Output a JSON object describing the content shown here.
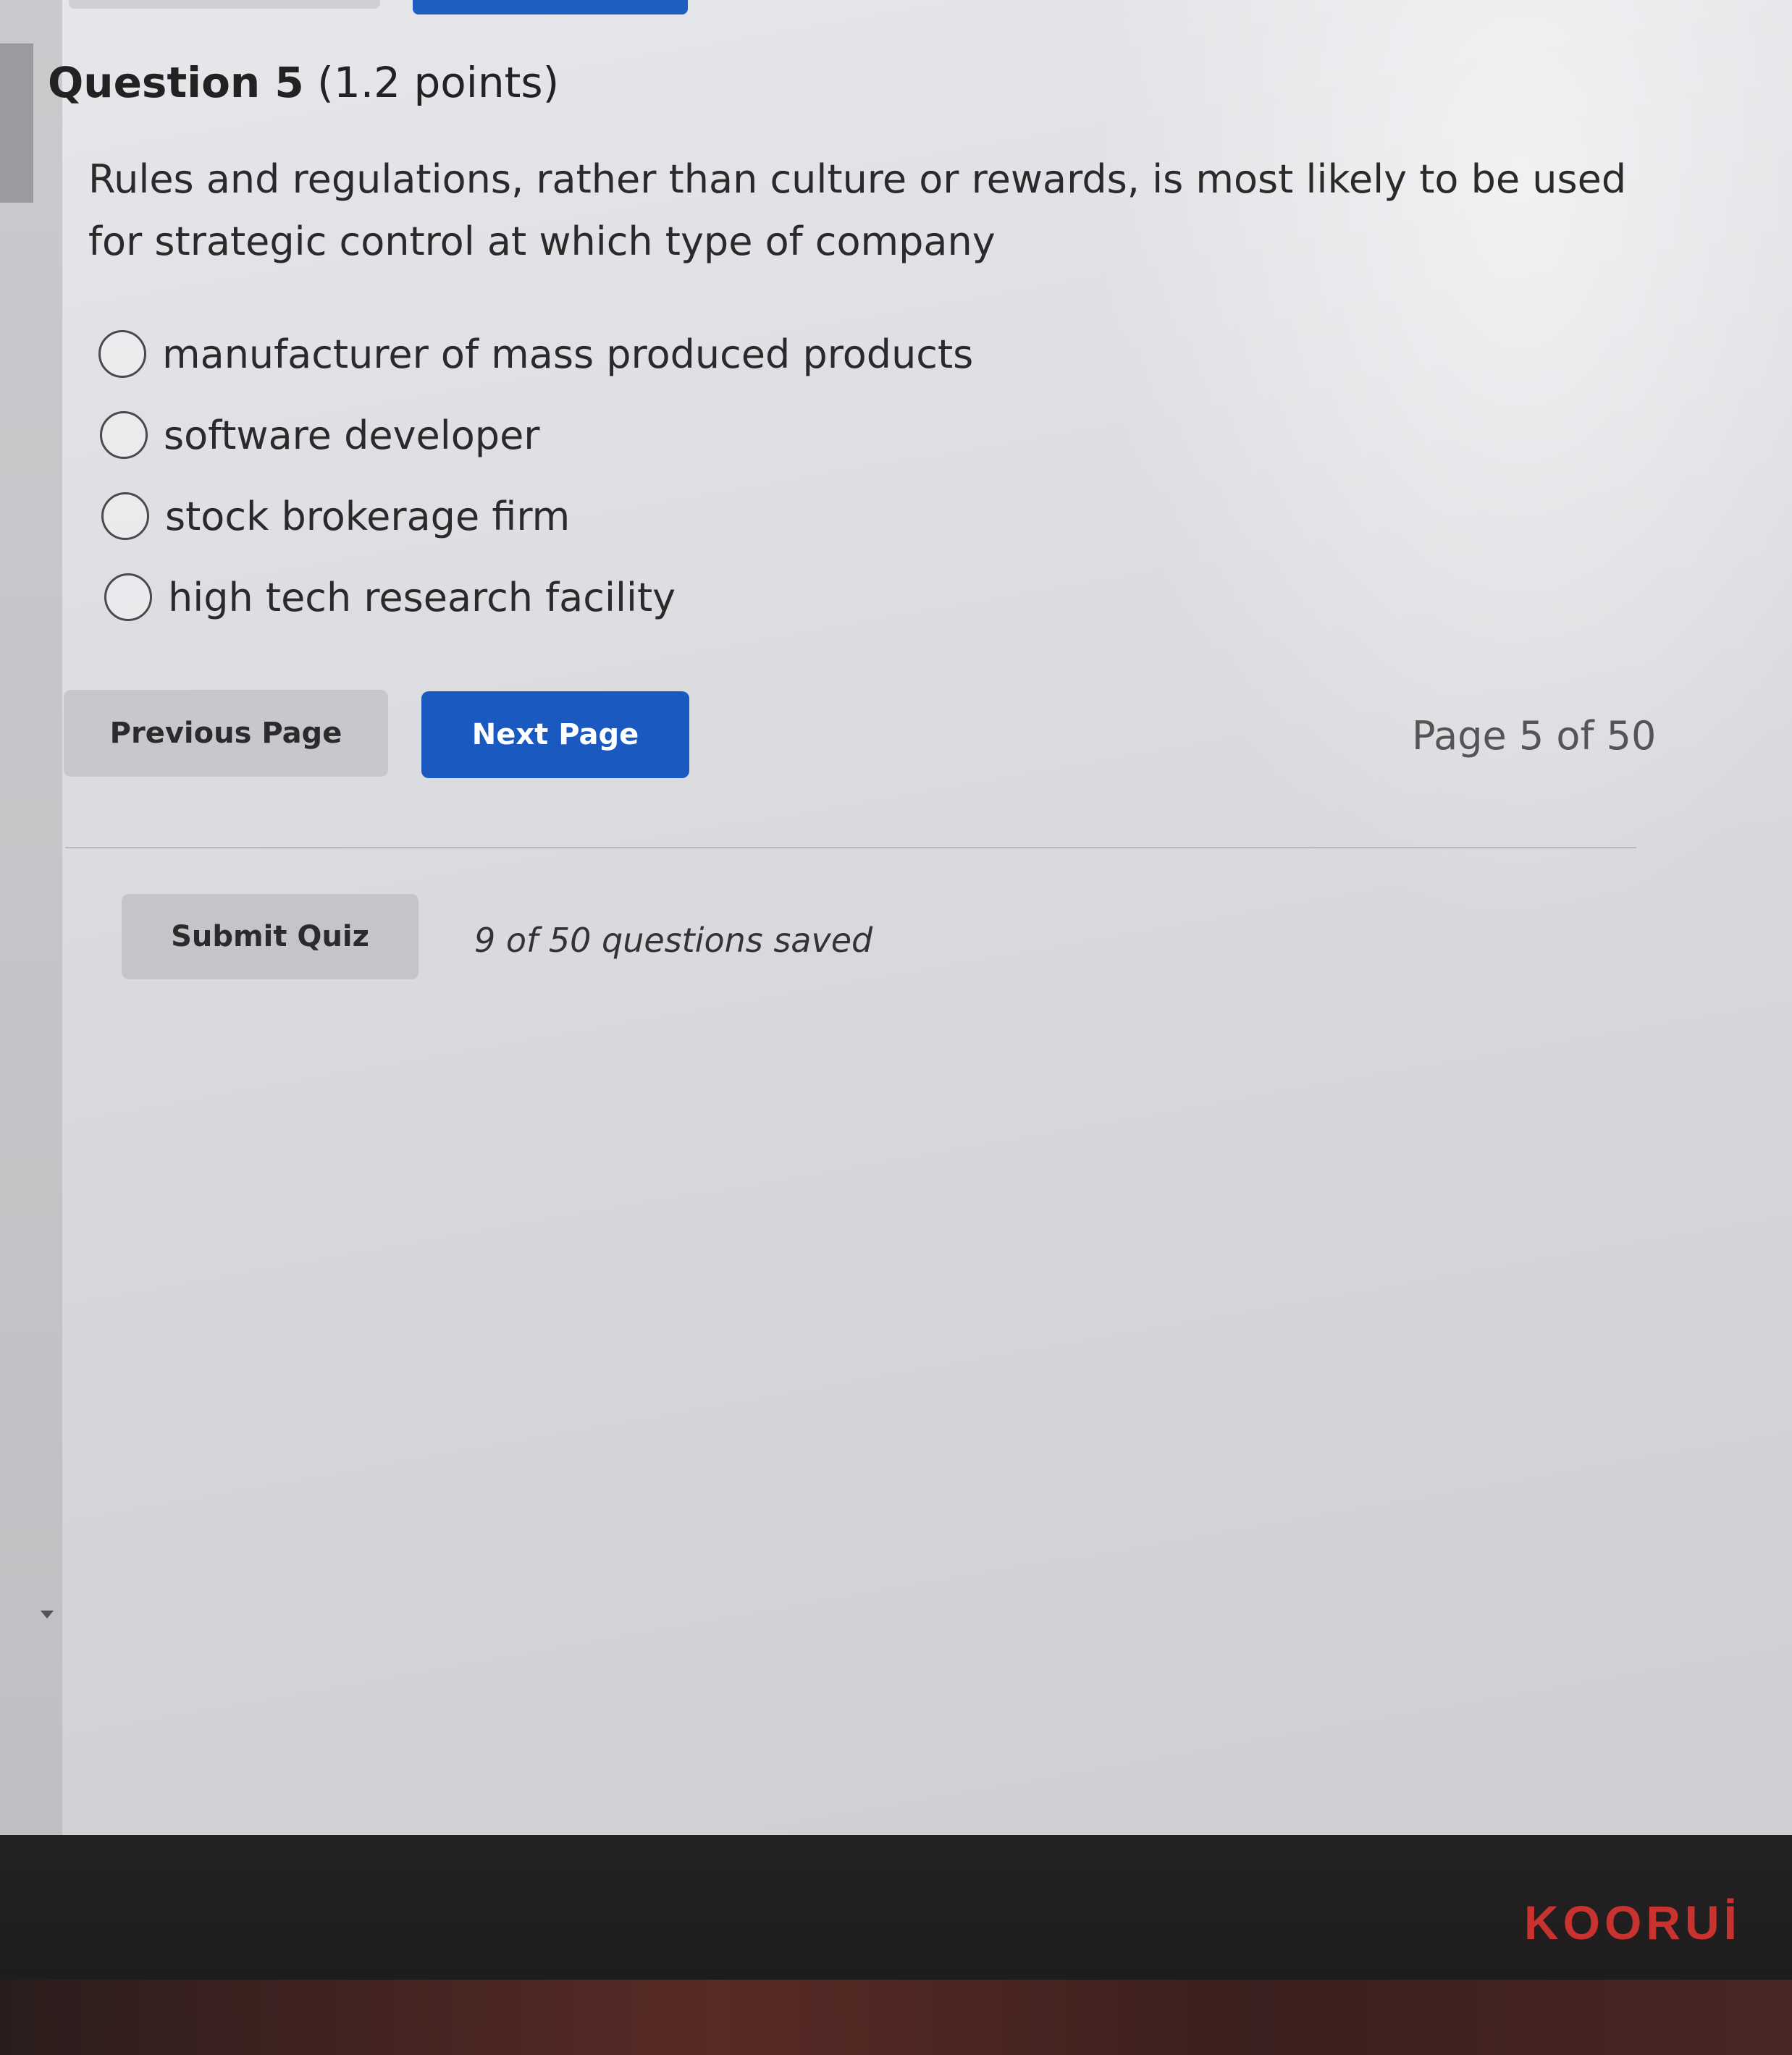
{
  "question": {
    "label": "Question 5",
    "points": " (1.2 points)",
    "text": "Rules and regulations, rather than culture or rewards, is most likely to be used for strategic control at which type of company"
  },
  "options": [
    {
      "label": "manufacturer of mass produced products",
      "selected": false
    },
    {
      "label": "software developer",
      "selected": false
    },
    {
      "label": "stock brokerage firm",
      "selected": false
    },
    {
      "label": "high tech research facility",
      "selected": false
    }
  ],
  "nav": {
    "previous_label": "Previous Page",
    "next_label": "Next Page",
    "page_indicator": "Page 5 of 50"
  },
  "footer": {
    "submit_label": "Submit Quiz",
    "saved_status": "9 of 50 questions saved"
  },
  "monitor": {
    "brand": "KOORUİ"
  },
  "colors": {
    "primary_button": "#1a5ac0",
    "secondary_button": "#c6c8cd",
    "brand_red": "#c8322f"
  }
}
